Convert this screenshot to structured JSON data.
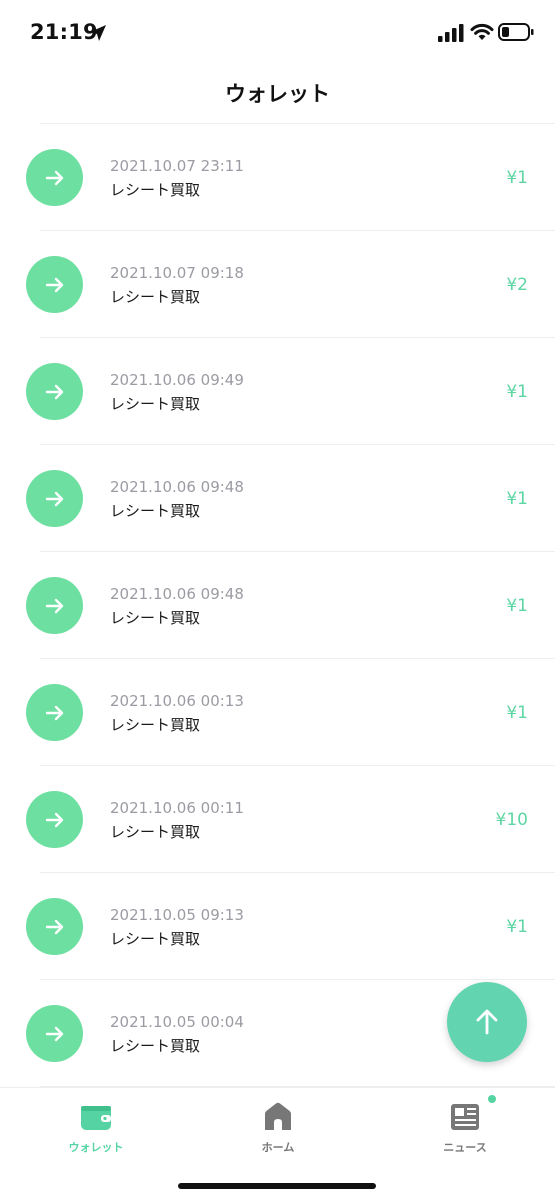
{
  "status_bar": {
    "time": "21:19"
  },
  "header": {
    "title": "ウォレット"
  },
  "transactions": [
    {
      "date": "2021.10.07 23:11",
      "label": "レシート買取",
      "amount": "¥1"
    },
    {
      "date": "2021.10.07 09:18",
      "label": "レシート買取",
      "amount": "¥2"
    },
    {
      "date": "2021.10.06 09:49",
      "label": "レシート買取",
      "amount": "¥1"
    },
    {
      "date": "2021.10.06 09:48",
      "label": "レシート買取",
      "amount": "¥1"
    },
    {
      "date": "2021.10.06 09:48",
      "label": "レシート買取",
      "amount": "¥1"
    },
    {
      "date": "2021.10.06 00:13",
      "label": "レシート買取",
      "amount": "¥1"
    },
    {
      "date": "2021.10.06 00:11",
      "label": "レシート買取",
      "amount": "¥10"
    },
    {
      "date": "2021.10.05 09:13",
      "label": "レシート買取",
      "amount": "¥1"
    },
    {
      "date": "2021.10.05 00:04",
      "label": "レシート買取",
      "amount": ""
    }
  ],
  "tabs": [
    {
      "label": "ウォレット",
      "icon": "wallet-icon",
      "active": true
    },
    {
      "label": "ホーム",
      "icon": "home-icon",
      "active": false
    },
    {
      "label": "ニュース",
      "icon": "news-icon",
      "active": false
    }
  ],
  "colors": {
    "accent": "#6ddfa1",
    "amount": "#5ed6a3",
    "fab": "#62d4b0"
  }
}
